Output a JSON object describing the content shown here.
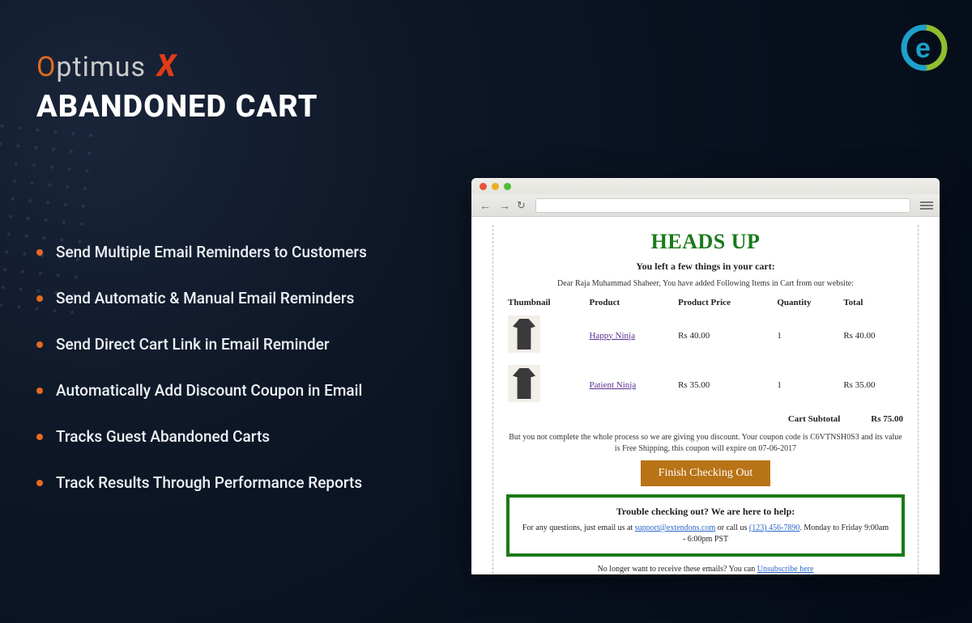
{
  "brand": {
    "optimus_o": "O",
    "optimus_rest": "ptimus",
    "optimus_x": "X"
  },
  "title": "ABANDONED CART",
  "features": [
    "Send Multiple Email Reminders to Customers",
    "Send Automatic & Manual Email Reminders",
    "Send Direct Cart Link in Email Reminder",
    "Automatically Add Discount Coupon in Email",
    "Tracks Guest Abandoned Carts",
    "Track Results Through Performance Reports"
  ],
  "email": {
    "heading": "HEADS UP",
    "subheading": "You left a few things in your cart:",
    "greeting": "Dear Raja Muhammad Shaheer, You have added Following Items in Cart from our website:",
    "columns": {
      "thumbnail": "Thumbnail",
      "product": "Product",
      "price": "Product Price",
      "qty": "Quantity",
      "total": "Total"
    },
    "items": [
      {
        "name": "Happy Ninja",
        "price": "Rs 40.00",
        "qty": "1",
        "total": "Rs 40.00"
      },
      {
        "name": "Patient Ninja",
        "price": "Rs 35.00",
        "qty": "1",
        "total": "Rs 35.00"
      }
    ],
    "subtotal_label": "Cart Subtotal",
    "subtotal_value": "Rs 75.00",
    "coupon_text": "But you not complete the whole process so we are giving you discount. Your coupon code is C6VTNSH0S3 and its value is Free Shipping, this coupon will expire on 07-06-2017",
    "cta": "Finish Checking Out",
    "help": {
      "title": "Trouble checking out? We are here to help:",
      "pre": "For any questions, just email us at ",
      "email": "support@extendons.com",
      "mid": " or call us ",
      "phone": "(123) 456-7890",
      "post": ". Monday to Friday 9:00am - 6:00pm PST"
    },
    "unsub_pre": "No longer want to receive these emails? You can ",
    "unsub_link": "Unsubscribe here"
  }
}
